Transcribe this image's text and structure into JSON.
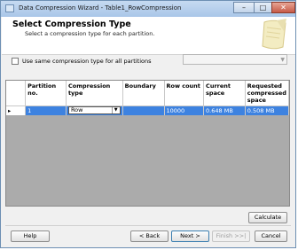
{
  "window": {
    "title": "Data Compression Wizard - Table1_RowCompression",
    "min_label": "–",
    "max_label": "□",
    "close_label": "✕"
  },
  "header": {
    "title": "Select Compression Type",
    "subtitle": "Select a compression type for each partition."
  },
  "options": {
    "same_type_label": "Use same compression type for all partitions",
    "same_type_checked": false,
    "type_combo_value": ""
  },
  "grid": {
    "columns": [
      "",
      "Partition no.",
      "Compression type",
      "Boundary",
      "Row count",
      "Current space",
      "Requested compressed space"
    ],
    "rows": [
      {
        "indicator": "▸",
        "partition": "1",
        "compression_type": "Row",
        "boundary": "",
        "row_count": "10000",
        "current_space": "0.648 MB",
        "requested_space": "0.508 MB"
      }
    ]
  },
  "buttons": {
    "calculate": "Calculate",
    "help": "Help",
    "back": "< Back",
    "next": "Next >",
    "finish": "Finish >>|",
    "cancel": "Cancel"
  },
  "colors": {
    "selection": "#3d82e0",
    "title_bar": "#b7cfec"
  }
}
